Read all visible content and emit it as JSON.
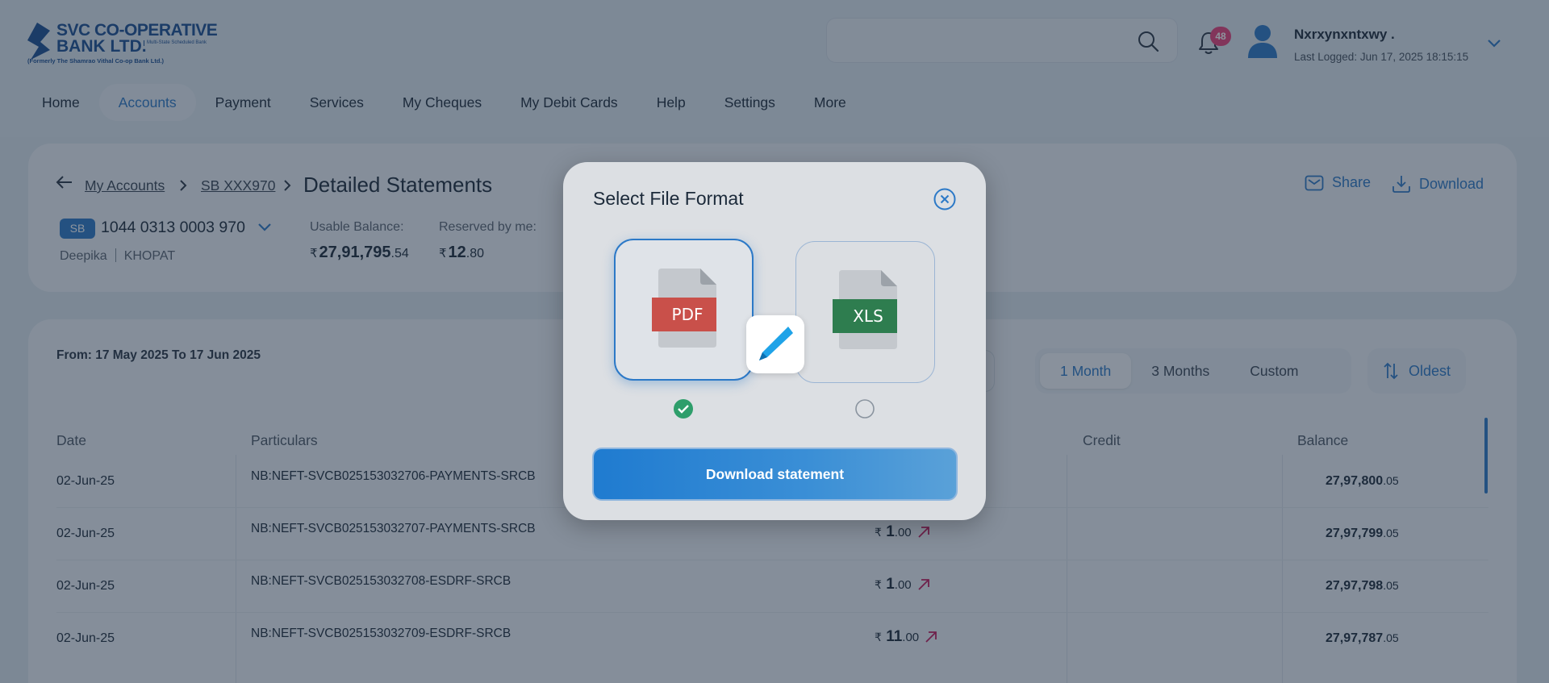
{
  "brand": {
    "line1": "SVC CO-OPERATIVE",
    "line2": "BANK LTD.",
    "tagline": "Multi-State Scheduled Bank",
    "formerly": "(Formerly The Shamrao Vithal Co-op Bank Ltd.)"
  },
  "header": {
    "search_placeholder": "",
    "notification_count": "48",
    "user_name": "Nxrxynxntxwy .",
    "last_logged": "Last Logged: Jun 17, 2025 18:15:15"
  },
  "nav": {
    "items": [
      {
        "label": "Home",
        "active": false
      },
      {
        "label": "Accounts",
        "active": true
      },
      {
        "label": "Payment",
        "active": false
      },
      {
        "label": "Services",
        "active": false
      },
      {
        "label": "My Cheques",
        "active": false
      },
      {
        "label": "My Debit Cards",
        "active": false
      },
      {
        "label": "Help",
        "active": false
      },
      {
        "label": "Settings",
        "active": false
      },
      {
        "label": "More",
        "active": false
      }
    ]
  },
  "account": {
    "breadcrumb": [
      "My Accounts",
      "SB XXX970"
    ],
    "page_title": "Detailed Statements",
    "share_label": "Share",
    "download_label": "Download",
    "type_tag": "SB",
    "number": "1044 0313 0003 970",
    "holder_first": "Deepika",
    "holder_last": "KHOPAT",
    "usable_balance_label": "Usable Balance:",
    "usable_balance_main": "27,91,795",
    "usable_balance_dec": ".54",
    "reserved_label": "Reserved by me:",
    "reserved_main": "12",
    "reserved_dec": ".80",
    "currency": "₹"
  },
  "statement": {
    "date_range": "From: 17 May 2025 To 17 Jun 2025",
    "periods": [
      {
        "label": "1 Month",
        "active": true
      },
      {
        "label": "3 Months",
        "active": false
      },
      {
        "label": "Custom",
        "active": false
      }
    ],
    "sort_label": "Oldest",
    "columns": [
      "Date",
      "Particulars",
      "Credit",
      "Balance"
    ],
    "rows": [
      {
        "date": "02-Jun-25",
        "particulars": "NB:NEFT-SVCB025153032706-PAYMENTS-SRCB",
        "debit_main": "",
        "debit_dec": "",
        "balance_main": "27,97,800",
        "balance_dec": ".05"
      },
      {
        "date": "02-Jun-25",
        "particulars": "NB:NEFT-SVCB025153032707-PAYMENTS-SRCB",
        "debit_main": "1",
        "debit_dec": ".00",
        "balance_main": "27,97,799",
        "balance_dec": ".05"
      },
      {
        "date": "02-Jun-25",
        "particulars": "NB:NEFT-SVCB025153032708-ESDRF-SRCB",
        "debit_main": "1",
        "debit_dec": ".00",
        "balance_main": "27,97,798",
        "balance_dec": ".05"
      },
      {
        "date": "02-Jun-25",
        "particulars": "NB:NEFT-SVCB025153032709-ESDRF-SRCB",
        "debit_main": "11",
        "debit_dec": ".00",
        "balance_main": "27,97,787",
        "balance_dec": ".05"
      }
    ]
  },
  "modal": {
    "title": "Select File Format",
    "options": [
      {
        "label": "PDF",
        "selected": true,
        "color": "#c9504a"
      },
      {
        "label": "XLS",
        "selected": false,
        "color": "#2e7d4f"
      }
    ],
    "download_button": "Download statement"
  },
  "colors": {
    "accent": "#2c79c7",
    "badge": "#e8417a",
    "debit_arrow": "#c2185b",
    "selected_check": "#2e9e6b"
  },
  "icons": [
    "search-icon",
    "bell-icon",
    "user-icon",
    "chevron-down-icon",
    "back-arrow-icon",
    "chevron-right-icon",
    "mail-icon",
    "download-icon",
    "sort-icon",
    "close-icon",
    "check-icon",
    "arrow-up-right-icon"
  ]
}
